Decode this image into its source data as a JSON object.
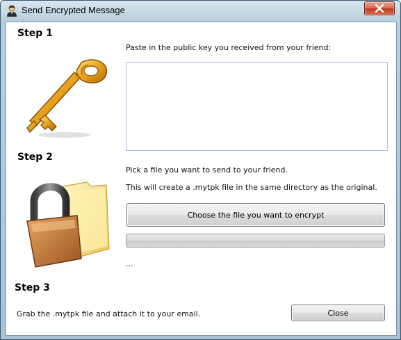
{
  "window": {
    "title": "Send Encrypted Message"
  },
  "step1": {
    "heading": "Step 1",
    "instruction": "Paste in the public key you received from your friend:",
    "public_key_value": ""
  },
  "step2": {
    "heading": "Step 2",
    "instruction_line1": "Pick a file you want to send to your friend.",
    "instruction_line2": "This will create a .mytpk file in the same directory as the original.",
    "choose_file_label": "Choose the file you want to encrypt",
    "progress_fraction": 0,
    "status_text": "..."
  },
  "step3": {
    "heading": "Step 3",
    "instruction": "Grab the .mytpk file and attach it to your email.",
    "close_label": "Close"
  },
  "icons": {
    "app": "user-icon",
    "close": "close-icon",
    "step1_art": "key-icon",
    "step2_art": "padlock-folder-icon"
  },
  "colors": {
    "close_button": "#c0391f",
    "key_gold": "#e7a21c"
  }
}
